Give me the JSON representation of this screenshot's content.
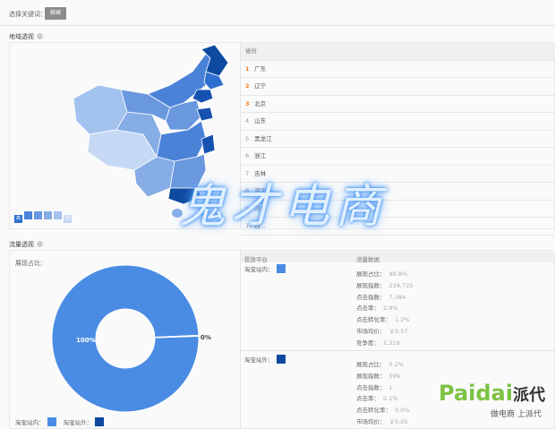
{
  "filter": {
    "label": "选择关键词：",
    "keyword": "棉裙"
  },
  "region": {
    "title": "地域透视",
    "legend": {
      "high": "高",
      "low": "低",
      "colors": [
        "#2f6fcf",
        "#4a82d8",
        "#6a98de",
        "#86ade6",
        "#a3c2ee",
        "#c6d9f4"
      ]
    },
    "table_header": "省份",
    "provinces": [
      {
        "rank": "1",
        "name": "广东"
      },
      {
        "rank": "2",
        "name": "辽宁"
      },
      {
        "rank": "3",
        "name": "北京"
      },
      {
        "rank": "4",
        "name": "山东"
      },
      {
        "rank": "5",
        "name": "黑龙江"
      },
      {
        "rank": "6",
        "name": "浙江"
      },
      {
        "rank": "7",
        "name": "吉林"
      },
      {
        "rank": "8",
        "name": "河北"
      },
      {
        "rank": "9",
        "name": "河南"
      },
      {
        "rank": "10",
        "name": "西..."
      }
    ]
  },
  "traffic": {
    "title": "流量透视",
    "pie_label": "展现占比：",
    "chart_data": {
      "type": "pie",
      "categories": [
        "淘宝站内",
        "淘宝站外"
      ],
      "values": [
        99.8,
        0.2
      ],
      "labels": [
        "100%",
        "0%"
      ],
      "colors": [
        "#4a8ce3",
        "#0d4aa0"
      ]
    },
    "legend": [
      {
        "label": "淘宝站内：",
        "color": "#4a8ce3"
      },
      {
        "label": "淘宝站外：",
        "color": "#0d4aa0"
      }
    ],
    "col_platform": "投放平台",
    "col_data": "流量数据",
    "platforms": [
      {
        "name": "淘宝站内：",
        "color": "#4a8ce3",
        "metrics": [
          {
            "k": "展现占比：",
            "v": "99.8%"
          },
          {
            "k": "展现指数：",
            "v": "234,725"
          },
          {
            "k": "点击指数：",
            "v": "7,384"
          },
          {
            "k": "点击率：",
            "v": "2.9%"
          },
          {
            "k": "点击转化率：",
            "v": "1.2%"
          },
          {
            "k": "市场均价：",
            "v": "￥0.57"
          },
          {
            "k": "竞争度：",
            "v": "2,319"
          }
        ]
      },
      {
        "name": "淘宝站外：",
        "color": "#0d4aa0",
        "metrics": [
          {
            "k": "展现占比：",
            "v": "0.2%"
          },
          {
            "k": "展现指数：",
            "v": "599"
          },
          {
            "k": "点击指数：",
            "v": "1"
          },
          {
            "k": "点击率：",
            "v": "0.1%"
          },
          {
            "k": "点击转化率：",
            "v": "0.0%"
          },
          {
            "k": "市场均价：",
            "v": "￥0.05"
          }
        ]
      }
    ]
  },
  "watermark": "鬼才电商",
  "logo": {
    "brand": "Paidai",
    "cn": "派代",
    "slogan": "做电商 上派代"
  }
}
